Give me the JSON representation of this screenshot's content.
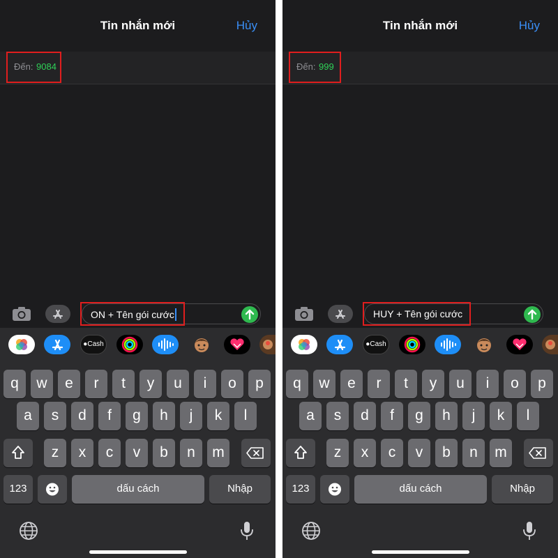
{
  "screens": [
    {
      "title": "Tin nhắn mới",
      "cancel_label": "Hủy",
      "to_label": "Đến:",
      "to_value": "9084",
      "message_text": "ON + Tên gói cước"
    },
    {
      "title": "Tin nhắn mới",
      "cancel_label": "Hủy",
      "to_label": "Đến:",
      "to_value": "999",
      "message_text": "HUY + Tên gói cước"
    }
  ],
  "app_strip": {
    "icons": [
      "photos-icon",
      "app-store-icon",
      "apple-cash-icon",
      "activity-icon",
      "audio-message-icon",
      "memoji-icon",
      "digital-touch-icon",
      "stickers-icon"
    ],
    "cash_label": "Cash"
  },
  "keyboard": {
    "row1": [
      "q",
      "w",
      "e",
      "r",
      "t",
      "y",
      "u",
      "i",
      "o",
      "p"
    ],
    "row2": [
      "a",
      "s",
      "d",
      "f",
      "g",
      "h",
      "j",
      "k",
      "l"
    ],
    "row3": [
      "z",
      "x",
      "c",
      "v",
      "b",
      "n",
      "m"
    ],
    "numbers_label": "123",
    "space_label": "dấu cách",
    "return_label": "Nhập"
  },
  "colors": {
    "accent_blue": "#3a8ff7",
    "recipient_green": "#30d158",
    "send_green": "#2fb94f",
    "highlight_red": "#e01e1e"
  }
}
